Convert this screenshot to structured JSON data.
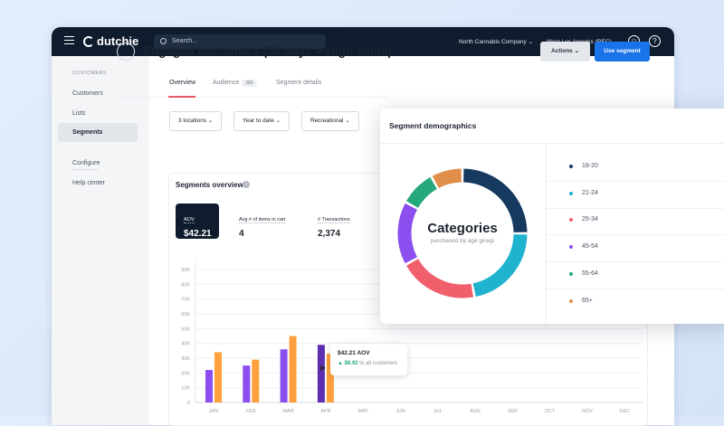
{
  "nav": {
    "brand": "dutchie",
    "search_placeholder": "Search...",
    "company": "North Cannabis Company",
    "location": "West Los Angeles (REC)",
    "help": "?"
  },
  "sidebar": {
    "header": "CUSTOMERS",
    "items": [
      {
        "label": "Customers"
      },
      {
        "label": "Lists"
      },
      {
        "label": "Segments"
      },
      {
        "label": "Configure"
      },
      {
        "label": "Help center"
      }
    ]
  },
  "page": {
    "title": "Engaged customers (30 days + High value)",
    "actions": "Actions",
    "use_segment": "Use segment"
  },
  "tabs": [
    {
      "label": "Overview"
    },
    {
      "label": "Audience",
      "count": "386"
    },
    {
      "label": "Segment details"
    }
  ],
  "filters": [
    "3 locations",
    "Year to date",
    "Recreational"
  ],
  "overview": {
    "title": "Segments overview",
    "kpis": [
      {
        "label": "AOV",
        "value": "$42.21"
      },
      {
        "label": "Avg # of items in cart",
        "value": "4"
      },
      {
        "label": "# Transactions",
        "value": "2,374"
      }
    ]
  },
  "tooltip": {
    "title": "$42.21 AOV",
    "delta": "$6.92",
    "suffix": "to all customers"
  },
  "demographics": {
    "title": "Segment demographics",
    "center_title": "Categories",
    "center_sub": "purchased by age group",
    "groups": [
      {
        "label": "18-20",
        "color": "#163a5f",
        "share": 25
      },
      {
        "label": "21-24",
        "color": "#1fb3cf",
        "share": 22
      },
      {
        "label": "25-34",
        "color": "#f25f6c",
        "share": 20
      },
      {
        "label": "45-54",
        "color": "#8b4ff0",
        "share": 16
      },
      {
        "label": "55-64",
        "color": "#25a97a",
        "share": 9
      },
      {
        "label": "65+",
        "color": "#e08f4a",
        "share": 8
      }
    ]
  },
  "chart_data": {
    "type": "bar",
    "categories": [
      "JAN",
      "FEB",
      "MAR",
      "APR",
      "MAY",
      "JUN",
      "JUL",
      "AUG",
      "SEP",
      "OCT",
      "NOV",
      "DEC"
    ],
    "yticks": [
      "0",
      "10K",
      "20K",
      "30K",
      "40K",
      "50K",
      "60K",
      "70K",
      "80K",
      "90K"
    ],
    "ylim": [
      0,
      90000
    ],
    "series": [
      {
        "name": "segment",
        "color": "#8b4ff0",
        "values": [
          22000,
          25000,
          36000,
          39000,
          null,
          null,
          null,
          null,
          null,
          null,
          null,
          null
        ]
      },
      {
        "name": "all customers",
        "color": "#ff9f3d",
        "values": [
          34000,
          29000,
          45000,
          33000,
          null,
          null,
          null,
          null,
          null,
          null,
          null,
          null
        ]
      }
    ]
  }
}
